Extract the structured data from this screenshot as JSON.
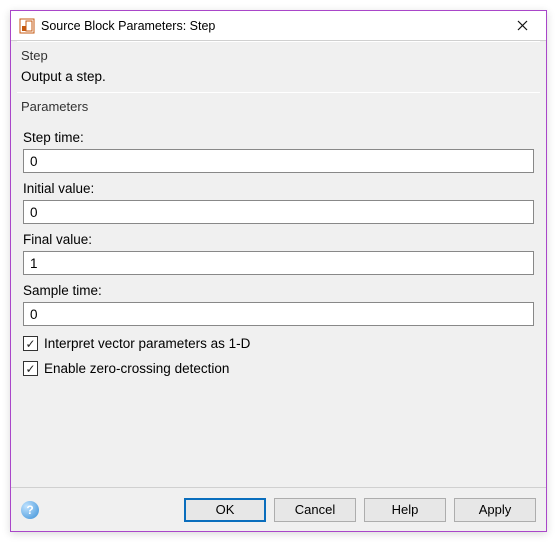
{
  "titlebar": {
    "title": "Source Block Parameters: Step"
  },
  "header": {
    "name": "Step",
    "description": "Output a step."
  },
  "parameters": {
    "section_label": "Parameters",
    "step_time": {
      "label": "Step time:",
      "value": "0"
    },
    "initial_value": {
      "label": "Initial value:",
      "value": "0"
    },
    "final_value": {
      "label": "Final value:",
      "value": "1"
    },
    "sample_time": {
      "label": "Sample time:",
      "value": "0"
    },
    "interpret_vector": {
      "label": "Interpret vector parameters as 1-D",
      "checked": true
    },
    "zero_crossing": {
      "label": "Enable zero-crossing detection",
      "checked": true
    }
  },
  "buttons": {
    "ok": "OK",
    "cancel": "Cancel",
    "help": "Help",
    "apply": "Apply"
  },
  "glyphs": {
    "check": "✓",
    "help": "?"
  }
}
